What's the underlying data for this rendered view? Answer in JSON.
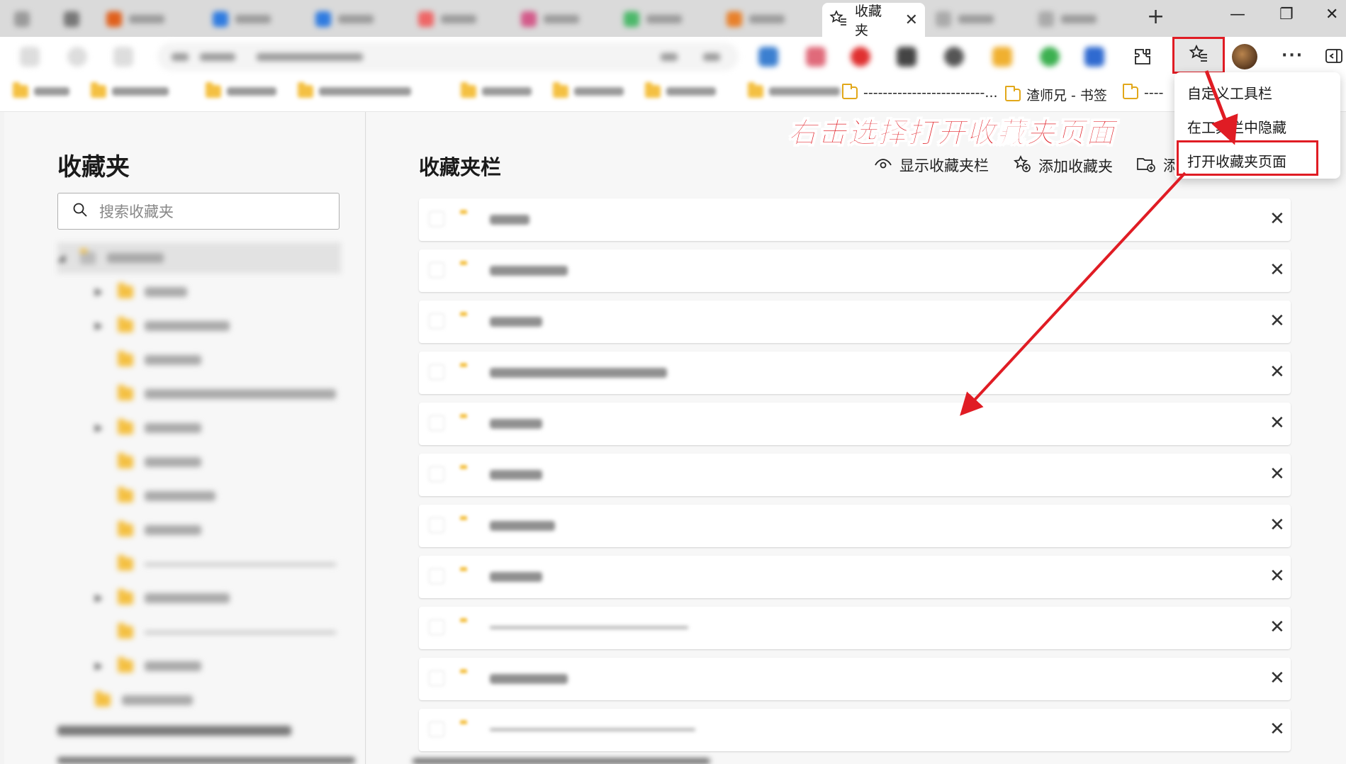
{
  "tabs": [
    {
      "label": "收藏夹",
      "active": true
    }
  ],
  "tab_close": "✕",
  "new_tab": "+",
  "window": {
    "minimize": "—",
    "maximize": "❐",
    "close": "✕"
  },
  "toolbar": {
    "more": "···"
  },
  "bookmarks_bar": {
    "items": [
      {
        "label": "-------------------------..."
      },
      {
        "label": "渣师兄 - 书签"
      },
      {
        "label": "----"
      }
    ]
  },
  "sidebar": {
    "title": "收藏夹",
    "search_placeholder": "搜索收藏夹"
  },
  "main": {
    "title": "收藏夹栏",
    "actions": [
      {
        "label": "显示收藏夹栏"
      },
      {
        "label": "添加收藏夹"
      },
      {
        "label": "添"
      }
    ],
    "close_glyph": "✕"
  },
  "context_menu": {
    "items": [
      {
        "label": "自定义工具栏"
      },
      {
        "label": "在工具栏中隐藏"
      },
      {
        "label": "打开收藏夹页面"
      }
    ]
  },
  "annotation": "右击选择打开收藏夹页面",
  "colors": {
    "accent": "#e01c24",
    "folder": "#f4c042"
  },
  "icons": [
    "star-list-icon",
    "extensions-icon",
    "avatar",
    "folder-icon",
    "eye-icon",
    "star-add-icon",
    "folder-add-icon",
    "search-icon",
    "close-icon"
  ]
}
